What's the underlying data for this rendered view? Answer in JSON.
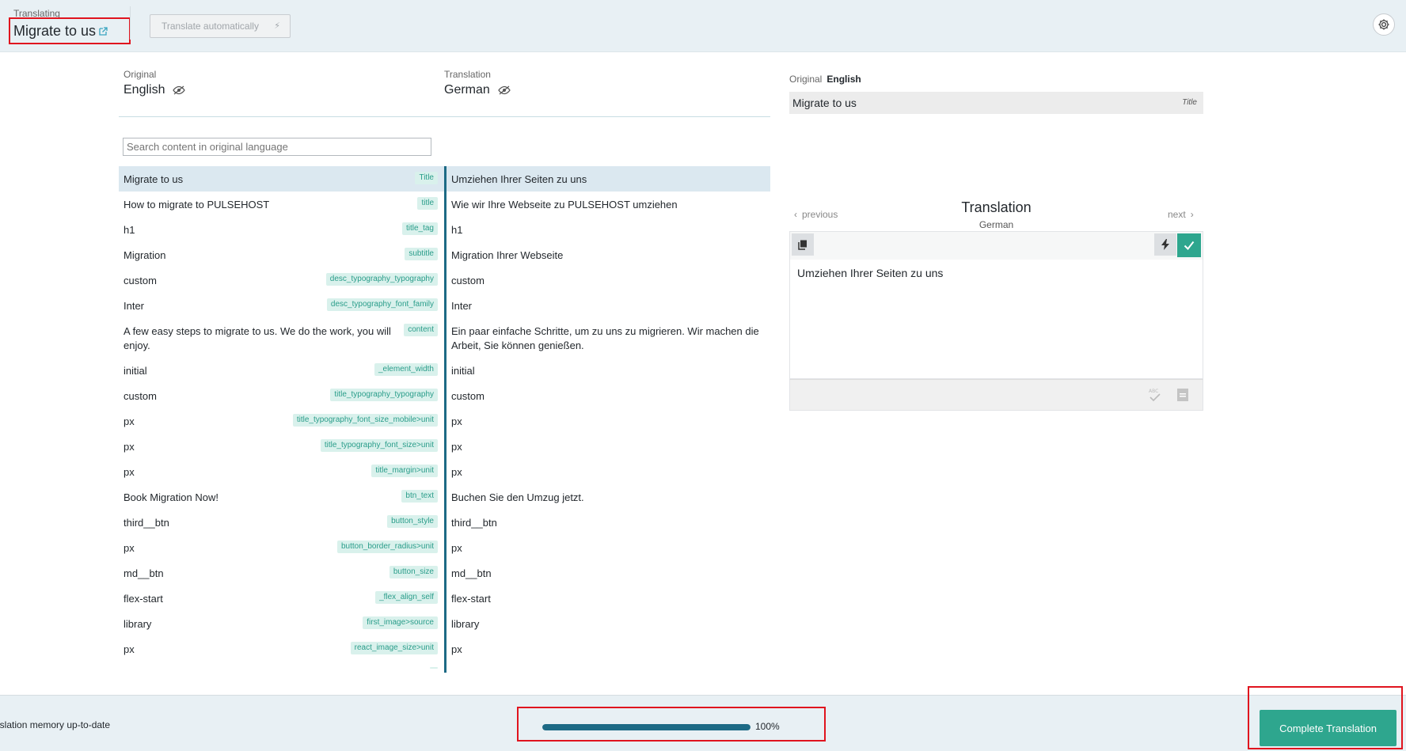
{
  "header": {
    "subtitle": "Translating",
    "title": "Migrate to us",
    "auto_translate_label": "Translate automatically"
  },
  "languages": {
    "original_label": "Original",
    "original_name": "English",
    "translation_label": "Translation",
    "translation_name": "German"
  },
  "search": {
    "placeholder": "Search content in original language"
  },
  "rows": [
    {
      "orig": "Migrate to us",
      "tag": "Title",
      "trans": "Umziehen Ihrer Seiten zu uns"
    },
    {
      "orig": "How to migrate to PULSEHOST",
      "tag": "title",
      "trans": "Wie wir Ihre Webseite zu PULSEHOST umziehen"
    },
    {
      "orig": "h1",
      "tag": "title_tag",
      "trans": "h1"
    },
    {
      "orig": "Migration",
      "tag": "subtitle",
      "trans": "Migration Ihrer Webseite"
    },
    {
      "orig": "custom",
      "tag": "desc_typography_typography",
      "trans": "custom"
    },
    {
      "orig": "Inter",
      "tag": "desc_typography_font_family",
      "trans": "Inter"
    },
    {
      "orig": "A few easy steps to migrate to us. We do the work, you will enjoy.",
      "tag": "content",
      "trans": "Ein paar einfache Schritte, um zu uns zu migrieren. Wir machen die Arbeit, Sie können genießen."
    },
    {
      "orig": "initial",
      "tag": "_element_width",
      "trans": "initial"
    },
    {
      "orig": "custom",
      "tag": "title_typography_typography",
      "trans": "custom"
    },
    {
      "orig": "px",
      "tag": "title_typography_font_size_mobile>unit",
      "trans": "px"
    },
    {
      "orig": "px",
      "tag": "title_typography_font_size>unit",
      "trans": "px"
    },
    {
      "orig": "px",
      "tag": "title_margin>unit",
      "trans": "px"
    },
    {
      "orig": "Book Migration Now!",
      "tag": "btn_text",
      "trans": "Buchen Sie den Umzug jetzt."
    },
    {
      "orig": "third__btn",
      "tag": "button_style",
      "trans": "third__btn"
    },
    {
      "orig": "px",
      "tag": "button_border_radius>unit",
      "trans": "px"
    },
    {
      "orig": "md__btn",
      "tag": "button_size",
      "trans": "md__btn"
    },
    {
      "orig": "flex-start",
      "tag": "_flex_align_self",
      "trans": "flex-start"
    },
    {
      "orig": "library",
      "tag": "first_image>source",
      "trans": "library"
    },
    {
      "orig": "px",
      "tag": "react_image_size>unit",
      "trans": "px"
    },
    {
      "orig": " ",
      "tag": " ",
      "trans": " "
    }
  ],
  "right_panel": {
    "original_label": "Original",
    "original_lang": "English",
    "original_value": "Migrate to us",
    "original_field": "Title",
    "translation_heading": "Translation",
    "translation_lang": "German",
    "prev_label": "previous",
    "next_label": "next",
    "translation_value": "Umziehen Ihrer Seiten zu uns"
  },
  "footer": {
    "memory_status": "nslation memory up-to-date",
    "progress_percent": 100,
    "progress_label": "100%",
    "complete_label": "Complete Translation"
  },
  "colors": {
    "accent": "#2ea68e",
    "primary": "#1d6a85",
    "tag_text": "#2a9d8a",
    "selected_row": "#dbe8f0"
  }
}
